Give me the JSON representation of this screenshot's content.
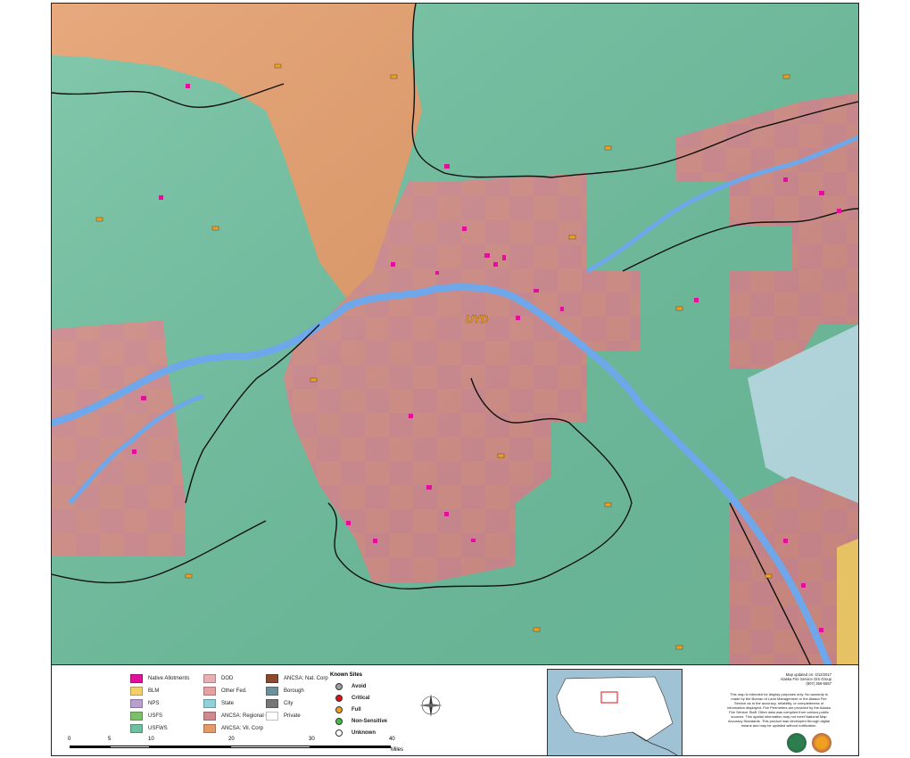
{
  "map": {
    "center_label": "UYD",
    "colors": {
      "state": "#6dbf9e",
      "usfws": "#6dbf9e",
      "regional_corp": "#d98f6b",
      "village_corp": "#e39a66",
      "native_allotment_pink": "#cf8a8f",
      "river": "#6fa8ea",
      "boundary": "#111111",
      "allotment": "#e0109a",
      "other_fed": "#b9e0e6",
      "blm": "#f5cf6a"
    }
  },
  "legend": {
    "land_status": [
      {
        "label": "Native Allotments",
        "color": "#e0109a",
        "icon": "native-allotment-icon"
      },
      {
        "label": "BLM",
        "color": "#f5cf6a",
        "icon": "blm-icon"
      },
      {
        "label": "NPS",
        "color": "#b99fd0",
        "icon": "nps-icon"
      },
      {
        "label": "USFS",
        "color": "#7cc06a",
        "icon": "usfs-icon"
      },
      {
        "label": "USFWS",
        "color": "#6dbf9e",
        "icon": "usfws-icon"
      },
      {
        "label": "DOD",
        "color": "#e9b0b4",
        "icon": "dod-icon"
      },
      {
        "label": "Other Fed.",
        "color": "#e79f9f",
        "icon": "other-fed-icon"
      },
      {
        "label": "State",
        "color": "#8fd0d9",
        "icon": "state-icon"
      },
      {
        "label": "ANCSA: Regional Corp",
        "color": "#cf8a8f",
        "icon": "regional-corp-icon"
      },
      {
        "label": "ANCSA: Vil. Corp",
        "color": "#e39a66",
        "icon": "village-corp-icon"
      },
      {
        "label": "ANCSA: Nat. Corp",
        "color": "#8b4a2b",
        "icon": "native-corp-icon"
      },
      {
        "label": "Borough",
        "color": "#6c8f9a",
        "icon": "borough-icon"
      },
      {
        "label": "City",
        "color": "#777777",
        "icon": "city-icon"
      },
      {
        "label": "Private",
        "color": "#ffffff",
        "icon": "private-icon"
      }
    ],
    "known_sites_title": "Known Sites",
    "known_sites": [
      {
        "label": "Avoid",
        "color": "#9e9e9e"
      },
      {
        "label": "Critical",
        "color": "#e01010"
      },
      {
        "label": "Full",
        "color": "#f0a020"
      },
      {
        "label": "Non-Sensitive",
        "color": "#40c040"
      },
      {
        "label": "Unknown",
        "color": "#ffffff"
      }
    ],
    "scale_ticks": [
      "0",
      "5",
      "10",
      "20",
      "30",
      "40"
    ],
    "scale_unit": "Miles",
    "credit_lines": [
      "Map updated on: 4/12/2017",
      "Alaska Fire Service GIS Group",
      "(907) 356-5657"
    ],
    "notice": "This map is intended for display purposes only. No warranty is made by the Bureau of Land Management or the Alaska Fire Service as to the accuracy, reliability, or completeness of information displayed. Fire Perimeters are provided by the Alaska Fire Service Staff. Other data was compiled from various public sources. This spatial information may not meet National Map Accuracy Standards. This product was developed through digital means and may be updated without notification."
  }
}
